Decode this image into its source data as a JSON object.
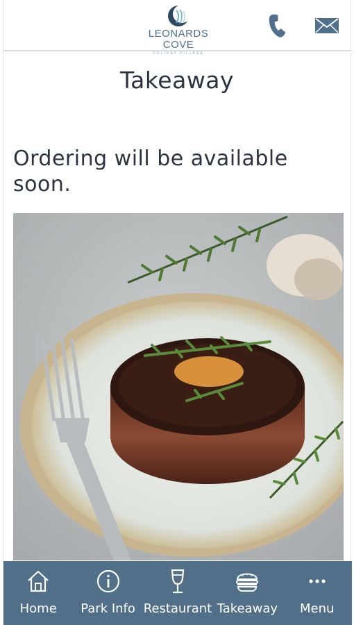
{
  "header": {
    "logo": {
      "name": "LEONARDS COVE",
      "subtitle": "HOLIDAY VILLAGE"
    },
    "phone_icon": "phone-icon",
    "mail_icon": "mail-icon"
  },
  "page": {
    "title": "Takeaway",
    "notice": "Ordering will be available soon."
  },
  "bottom_nav": {
    "items": [
      {
        "label": "Home",
        "icon": "home-icon"
      },
      {
        "label": "Park Info",
        "icon": "info-icon"
      },
      {
        "label": "Restaurant",
        "icon": "wine-glass-icon"
      },
      {
        "label": "Takeaway",
        "icon": "burger-icon"
      },
      {
        "label": "Menu",
        "icon": "more-dots-icon"
      }
    ]
  },
  "colors": {
    "nav_background": "#516f89",
    "logo_blue": "#4f6f8c",
    "text_dark": "#2b3340"
  }
}
